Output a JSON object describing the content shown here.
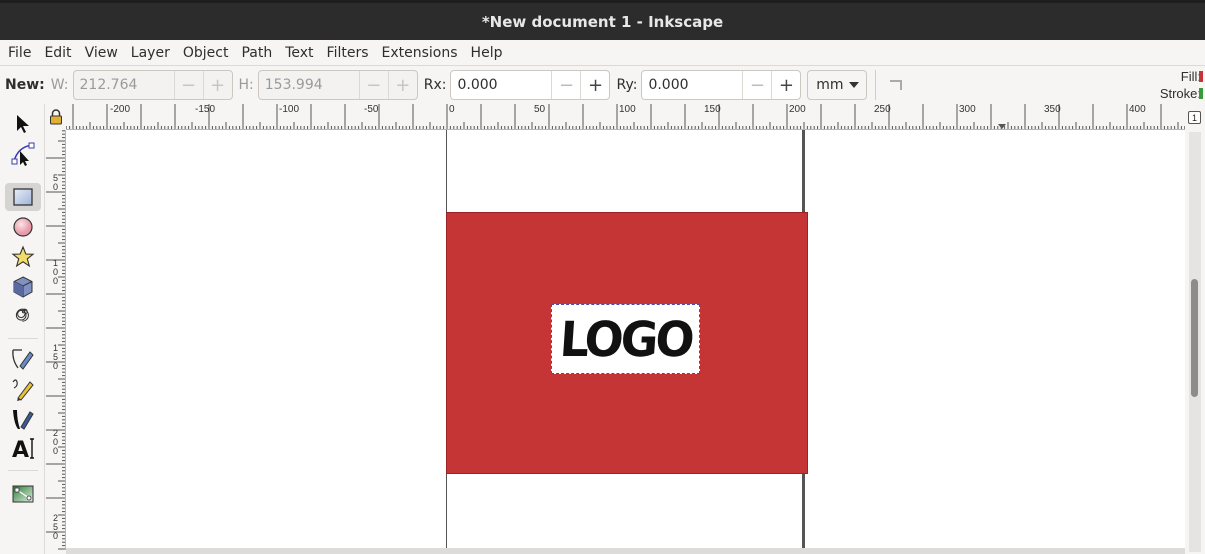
{
  "window": {
    "title": "*New document 1 - Inkscape"
  },
  "menu": [
    "File",
    "Edit",
    "View",
    "Layer",
    "Object",
    "Path",
    "Text",
    "Filters",
    "Extensions",
    "Help"
  ],
  "tool_controls": {
    "new_label": "New:",
    "w_label": "W:",
    "w_value": "212.764",
    "h_label": "H:",
    "h_value": "153.994",
    "rx_label": "Rx:",
    "rx_value": "0.000",
    "ry_label": "Ry:",
    "ry_value": "0.000",
    "unit": "mm",
    "minus": "−",
    "plus": "+"
  },
  "style_indicator": {
    "fill_label": "Fill:",
    "stroke_label": "Stroke:",
    "fill_color": "#c63535",
    "stroke_color": "#3a9a3a"
  },
  "toolbox": [
    "selector-icon",
    "node-editor-icon",
    "rectangle-icon",
    "ellipse-icon",
    "star-icon",
    "3d-box-icon",
    "spiral-icon",
    "pen-icon",
    "pencil-icon",
    "calligraphy-icon",
    "text-icon",
    "gradient-icon"
  ],
  "ruler": {
    "h_labels": [
      "-200",
      "-150",
      "-100",
      "-50",
      "0",
      "50",
      "100",
      "150",
      "200",
      "250",
      "300",
      "350",
      "400"
    ],
    "v_labels": [
      "5",
      "1",
      "1",
      "2",
      "2"
    ],
    "v_labels_b": [
      "0",
      "0",
      "5",
      "0",
      "5"
    ],
    "v_labels_c": [
      "",
      "0",
      "0",
      "0",
      "0"
    ]
  },
  "vscroll_label": "1",
  "canvas": {
    "rect_color": "#c63535",
    "logo_text": "LOGO"
  }
}
